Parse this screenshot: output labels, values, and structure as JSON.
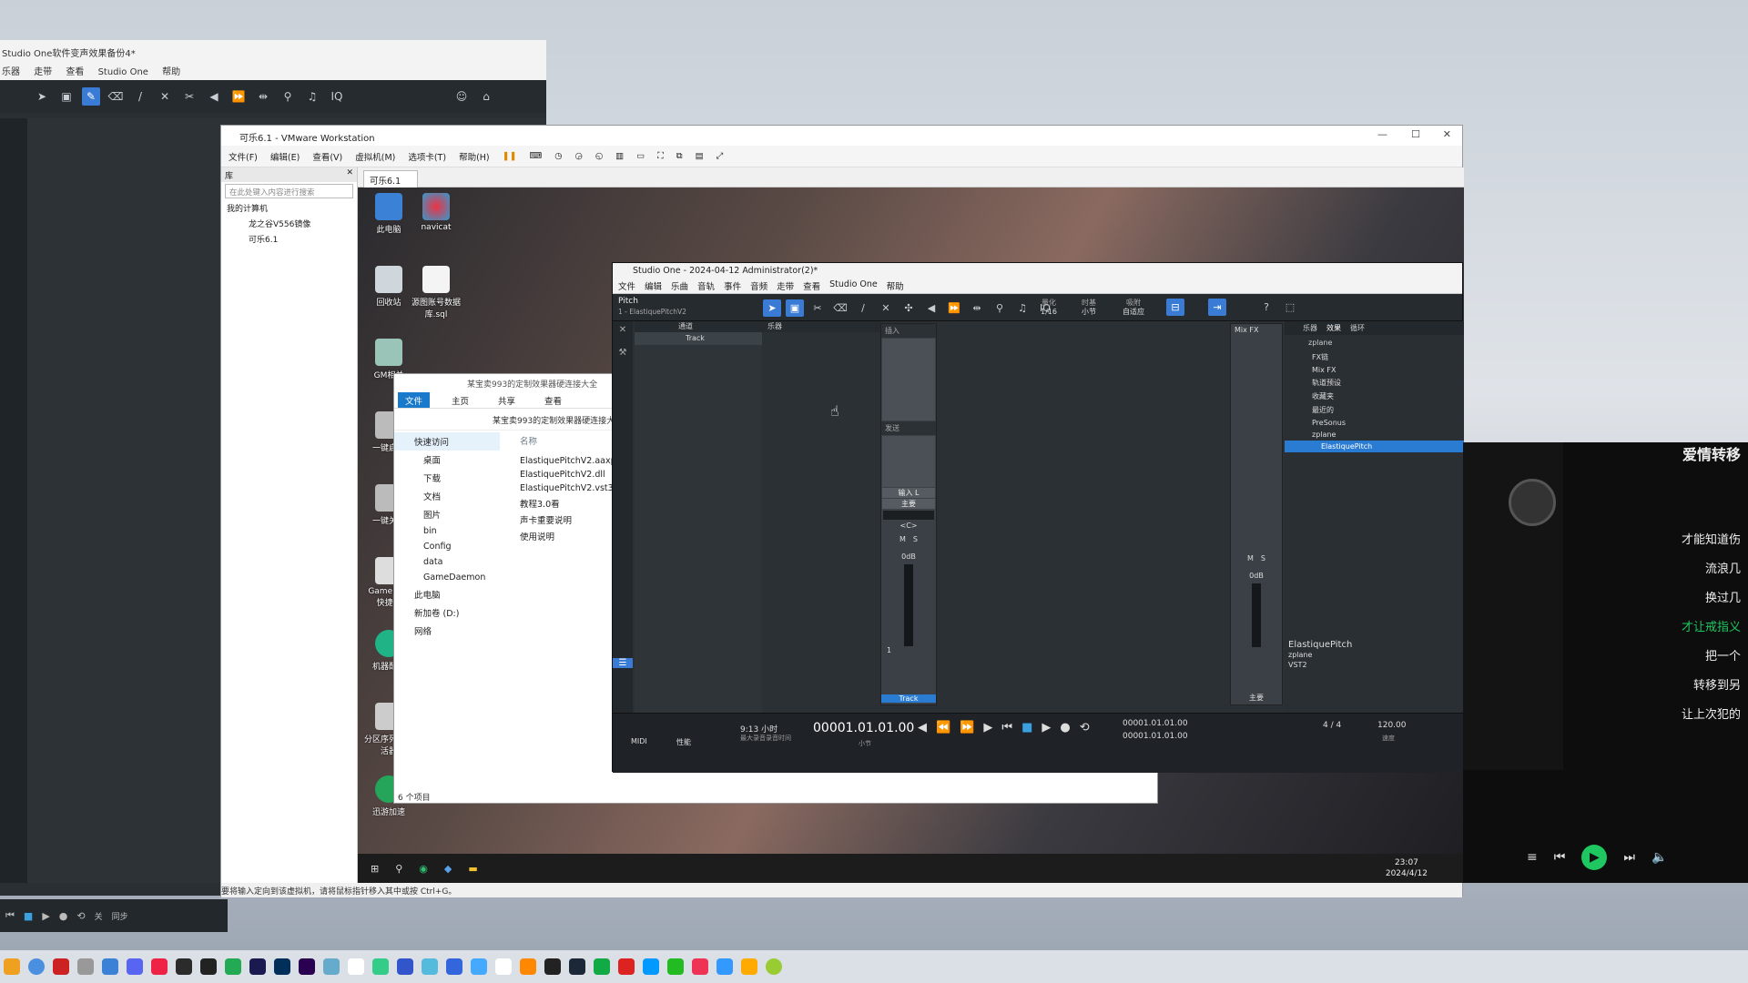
{
  "host_left_app": {
    "title": "Studio One软件变声效果备份4*",
    "menu": [
      "乐器",
      "走带",
      "查看",
      "Studio One",
      "帮助"
    ],
    "transport_labels": [
      "关",
      "同步"
    ]
  },
  "vmware": {
    "title": "可乐6.1 - VMware Workstation",
    "menu": [
      "文件(F)",
      "编辑(E)",
      "查看(V)",
      "虚拟机(M)",
      "选项卡(T)",
      "帮助(H)"
    ],
    "library_label": "库",
    "search_placeholder": "在此处键入内容进行搜索",
    "tree": [
      "我的计算机",
      "龙之谷V556镜像",
      "可乐6.1"
    ],
    "tab_label": "可乐6.1",
    "status_text": "要将输入定向到该虚拟机，请将鼠标指针移入其中或按 Ctrl+G。"
  },
  "guest": {
    "desktop_icons": [
      "此电脑",
      "navicat",
      "回收站",
      "源图账号数据库.sql",
      "GM相关",
      "一键启动",
      "一键关闭",
      "GameDa - 快捷方",
      "机器配置",
      "分区序列 - 激活器",
      "迅游加速"
    ],
    "clock_time": "23:07",
    "clock_date": "2024/4/12"
  },
  "explorer": {
    "title": "某宝卖993的定制效果器硬连接大全",
    "ribbon": [
      "文件",
      "主页",
      "共享",
      "查看"
    ],
    "address": "某宝卖993的定制效果器硬连接大全",
    "nav": [
      "快速访问",
      "桌面",
      "下载",
      "文档",
      "图片",
      "bin",
      "Config",
      "data",
      "GameDaemon",
      "此电脑",
      "新加卷 (D:)",
      "网络"
    ],
    "col_name": "名称",
    "files": [
      "ElastiquePitchV2.aaxp",
      "ElastiquePitchV2.dll",
      "ElastiquePitchV2.vst3",
      "教程3.0看",
      "声卡重要说明",
      "使用说明"
    ],
    "status": "6 个项目"
  },
  "studio_one": {
    "title": "Studio One - 2024-04-12 Administrator(2)*",
    "menu": [
      "文件",
      "编辑",
      "乐曲",
      "音轨",
      "事件",
      "音频",
      "走带",
      "查看",
      "Studio One",
      "帮助"
    ],
    "preset": "Pitch",
    "preset_sub": "1 - ElastiquePitchV2",
    "quantize_label": "量化",
    "quantize_value": "1/16",
    "timebase_label": "时基",
    "timebase_value": "小节",
    "snap_label": "吸附",
    "snap_value": "自适应",
    "tabs": [
      "通道",
      "乐器"
    ],
    "track_name": "Track",
    "insert_label": "插入",
    "send_label": "发送",
    "input": "输入 L",
    "output": "主要",
    "pan": "<C>",
    "volume": "0dB",
    "track_number": "1",
    "channel_label": "Track",
    "mix_fx": "Mix FX",
    "right_volume": "0dB",
    "right_channel": "主要",
    "browser_tabs": [
      "乐器",
      "效果",
      "循环"
    ],
    "browser_sort": "zplane",
    "browser_tree": [
      "FX链",
      "Mix FX",
      "轨道预设",
      "收藏夹",
      "最近的",
      "PreSonus",
      "zplane",
      "ElastiquePitch"
    ],
    "plugin_name": "ElastiquePitch",
    "plugin_vendor": "zplane",
    "plugin_type": "VST2",
    "time_display": "00001.01.01.00",
    "time_unit": "小节",
    "duration": "9:13 小时",
    "duration_sub": "最大录音录音时间",
    "loop_start": "00001.01.01.00",
    "loop_end": "00001.01.01.00",
    "signature": "4 / 4",
    "tempo": "120.00",
    "tempo_label": "速度",
    "midi_label": "MIDI",
    "perf_label": "性能"
  },
  "player": {
    "song_title": "爱情转移",
    "lyrics": [
      "才能知道伤",
      "流浪几",
      "换过几",
      "才让戒指义",
      "把一个",
      "转移到另",
      "让上次犯的"
    ],
    "highlight_index": 3,
    "accent_color": "#1ec760"
  }
}
